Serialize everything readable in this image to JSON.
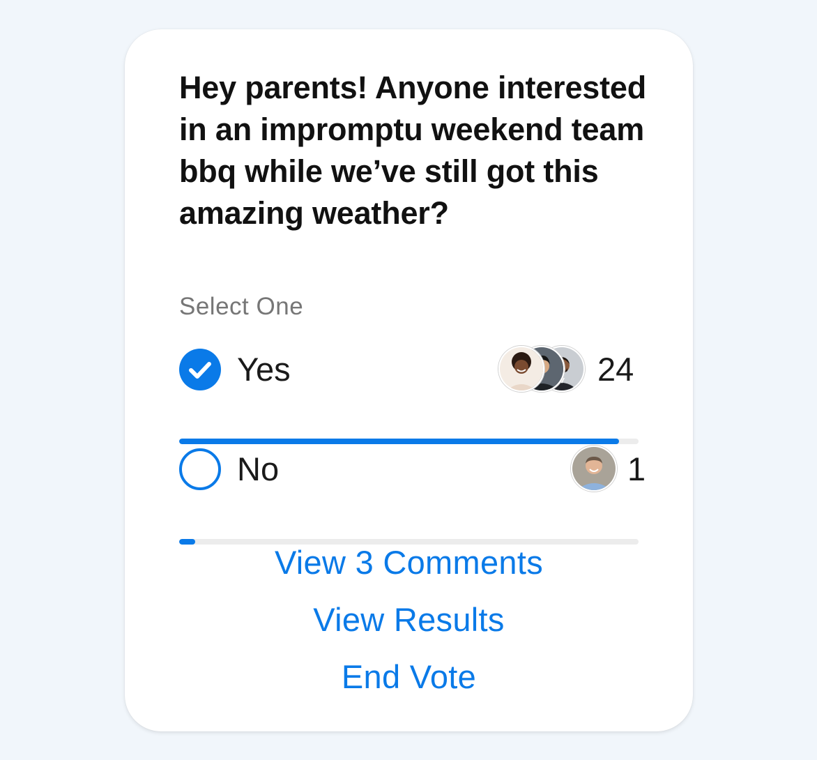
{
  "poll": {
    "question": "Hey parents! Anyone interested in an impromptu weekend team bbq while we’ve still got this amazing weather?",
    "subtitle": "Select One",
    "options": [
      {
        "label": "Yes",
        "count": "24",
        "selected": true,
        "progress_fraction": 0.958,
        "voter_avatars": [
          "woman-curly-hair-avatar",
          "man-dark-hair-avatar",
          "man-beard-suit-avatar"
        ]
      },
      {
        "label": "No",
        "count": "1",
        "selected": false,
        "progress_fraction": 0.035,
        "voter_avatars": [
          "man-bald-smiling-avatar"
        ]
      }
    ]
  },
  "actions": {
    "comments": "View 3 Comments",
    "results": "View Results",
    "end_vote": "End Vote"
  },
  "colors": {
    "accent": "#0a7ae8",
    "track": "#ececec",
    "background": "#f1f6fb",
    "card": "#ffffff"
  }
}
